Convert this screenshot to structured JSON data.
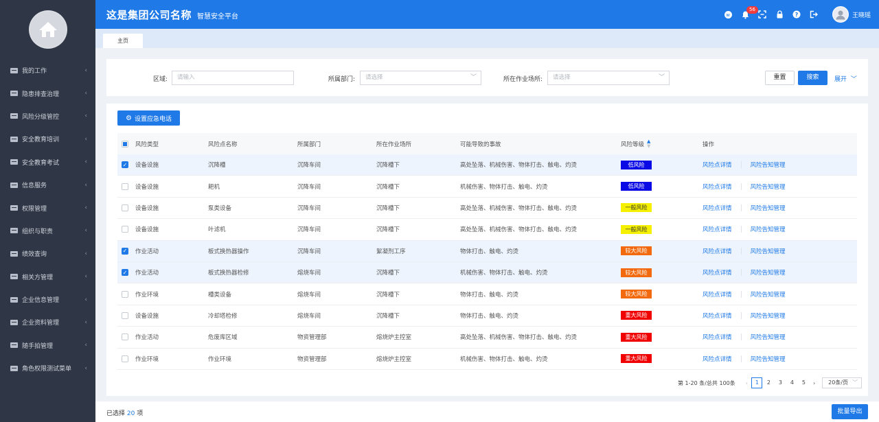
{
  "header": {
    "company": "这是集团公司名称",
    "platform": "智慧安全平台",
    "notification_count": "56",
    "username": "王晓瑶",
    "icons": [
      "weibo-icon",
      "bell-icon",
      "fullscreen-icon",
      "lock-icon",
      "help-icon",
      "logout-icon"
    ]
  },
  "sidebar": {
    "items": [
      {
        "label": "我的工作"
      },
      {
        "label": "隐患排查治理"
      },
      {
        "label": "风险分级管控"
      },
      {
        "label": "安全教育培训"
      },
      {
        "label": "安全教育考试"
      },
      {
        "label": "信息服务"
      },
      {
        "label": "权限管理"
      },
      {
        "label": "组织与职责"
      },
      {
        "label": "绩效查询"
      },
      {
        "label": "相关方管理"
      },
      {
        "label": "企业信息管理"
      },
      {
        "label": "企业资料管理"
      },
      {
        "label": "随手拍管理"
      },
      {
        "label": "角色权限测试菜单"
      }
    ]
  },
  "tabs": [
    {
      "label": "主页"
    }
  ],
  "search": {
    "area_label": "区域:",
    "area_placeholder": "请输入",
    "dept_label": "所属部门:",
    "dept_placeholder": "请选择",
    "site_label": "所在作业场所:",
    "site_placeholder": "请选择",
    "reset_label": "重置",
    "search_label": "搜索",
    "expand_label": "展开"
  },
  "toolbar": {
    "emergency_label": "设置应急电话"
  },
  "table": {
    "columns": [
      "风险类型",
      "风险点名称",
      "所属部门",
      "所在作业场所",
      "可能导致的事故",
      "风险等级",
      "操作"
    ],
    "action_detail": "风险点详情",
    "action_notice": "风险告知管理",
    "rows": [
      {
        "type": "设备设施",
        "name": "沉降槽",
        "dept": "沉降车间",
        "site": "沉降槽下",
        "accident": "高处坠落、机械伤害、物体打击、触电、灼烫",
        "level": "低风险",
        "level_color": "#0a0ae6",
        "checked": true
      },
      {
        "type": "设备设施",
        "name": "耙机",
        "dept": "沉降车间",
        "site": "沉降槽下",
        "accident": "机械伤害、物体打击、触电、灼烫",
        "level": "低风险",
        "level_color": "#0a0ae6",
        "checked": false
      },
      {
        "type": "设备设施",
        "name": "泵类设备",
        "dept": "沉降车间",
        "site": "沉降槽下",
        "accident": "高处坠落、机械伤害、物体打击、触电、灼烫",
        "level": "一般风险",
        "level_color": "#f5f000",
        "checked": false
      },
      {
        "type": "设备设施",
        "name": "叶滤机",
        "dept": "沉降车间",
        "site": "沉降槽下",
        "accident": "高处坠落、机械伤害、物体打击、触电、灼烫",
        "level": "一般风险",
        "level_color": "#f5f000",
        "checked": false
      },
      {
        "type": "作业活动",
        "name": "板式换热器操作",
        "dept": "沉降车间",
        "site": "絮凝剂工序",
        "accident": "物体打击、触电、灼烫",
        "level": "较大风险",
        "level_color": "#f26a0d",
        "checked": true
      },
      {
        "type": "作业活动",
        "name": "板式换热器检修",
        "dept": "熔烧车间",
        "site": "沉降槽下",
        "accident": "机械伤害、物体打击、触电、灼烫",
        "level": "较大风险",
        "level_color": "#f26a0d",
        "checked": true
      },
      {
        "type": "作业环境",
        "name": "槽类设备",
        "dept": "熔烧车间",
        "site": "沉降槽下",
        "accident": "物体打击、触电、灼烫",
        "level": "较大风险",
        "level_color": "#f26a0d",
        "checked": false
      },
      {
        "type": "设备设施",
        "name": "冷却塔检修",
        "dept": "熔烧车间",
        "site": "沉降槽下",
        "accident": "物体打击、触电、灼烫",
        "level": "重大风险",
        "level_color": "#f00000",
        "checked": false
      },
      {
        "type": "作业活动",
        "name": "危废库区域",
        "dept": "物资管理部",
        "site": "熔烧炉主控室",
        "accident": "高处坠落、机械伤害、物体打击、触电、灼烫",
        "level": "重大风险",
        "level_color": "#f00000",
        "checked": false
      },
      {
        "type": "作业环境",
        "name": "作业环境",
        "dept": "物资管理部",
        "site": "熔烧炉主控室",
        "accident": "机械伤害、物体打击、触电、灼烫",
        "level": "重大风险",
        "level_color": "#f00000",
        "checked": false
      }
    ]
  },
  "pagination": {
    "total_text": "第 1-20 条/总共 100条",
    "pages": [
      "1",
      "2",
      "3",
      "4",
      "5"
    ],
    "active_page": "1",
    "page_size": "20条/页"
  },
  "footer": {
    "selected_prefix": "已选择",
    "selected_count": "20",
    "selected_suffix": "项",
    "export_label": "批量导出"
  }
}
